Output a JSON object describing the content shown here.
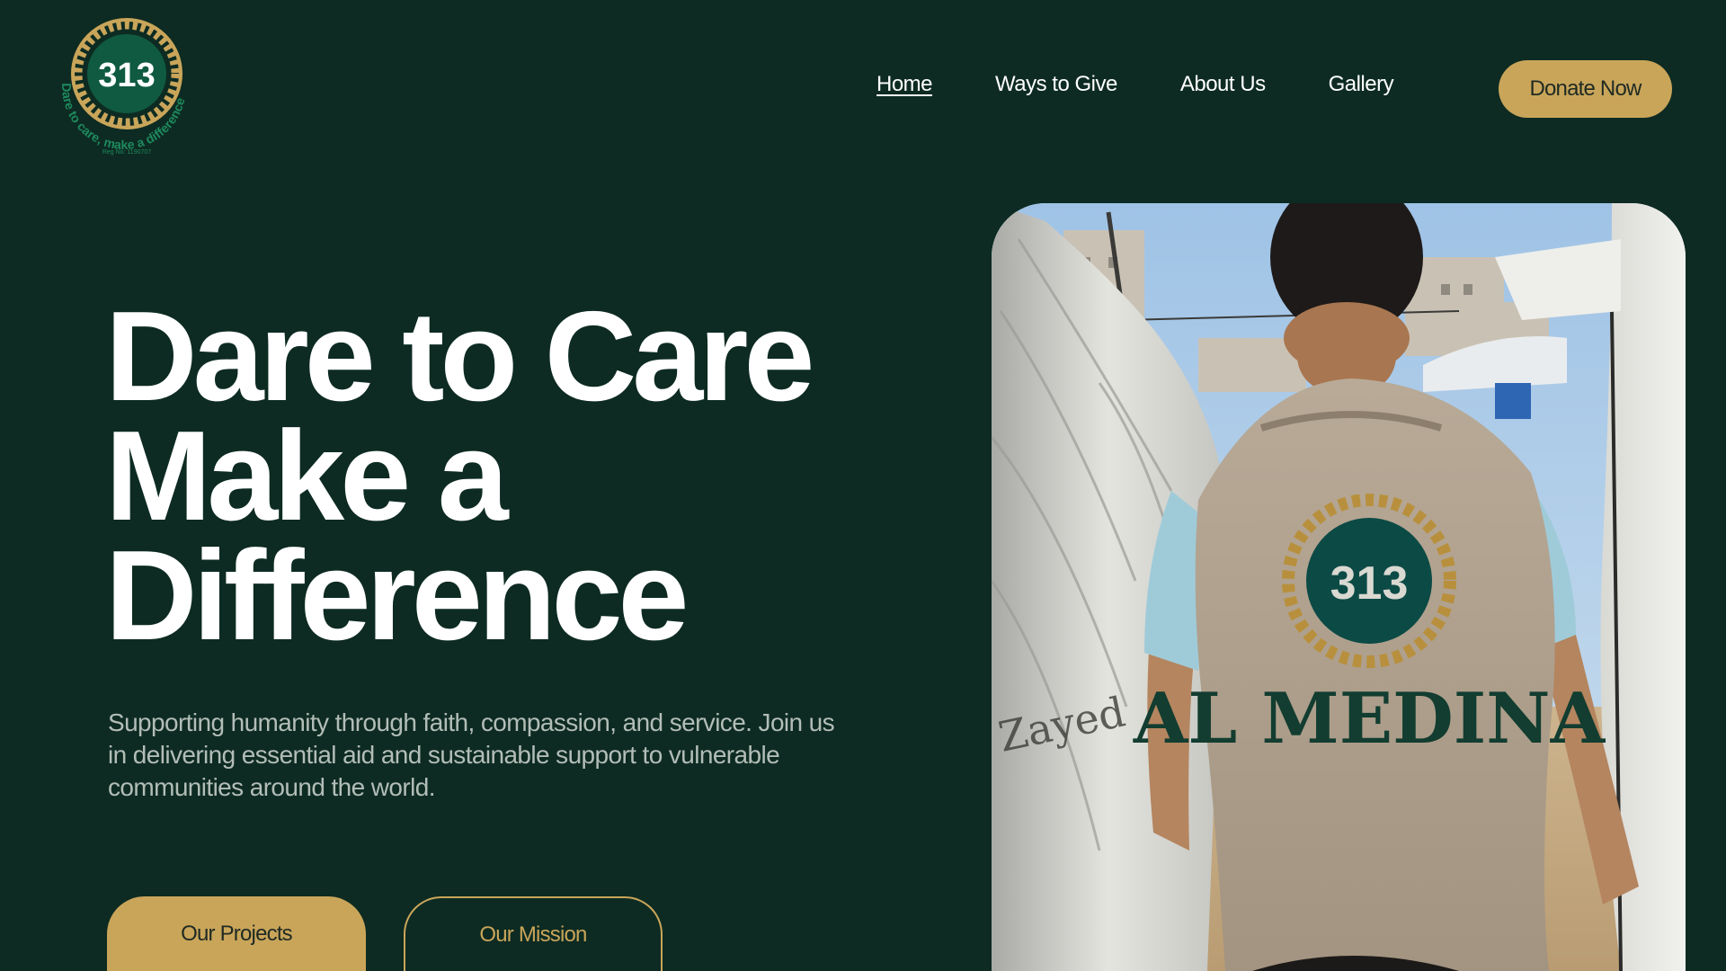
{
  "logo": {
    "number": "313",
    "tagline": "Dare to care, make a difference",
    "reg": "Reg No: 1190707",
    "colors": {
      "gold": "#c9a55a",
      "green": "#0f5a40",
      "tagline": "#1e8a5f"
    }
  },
  "nav": {
    "items": [
      {
        "label": "Home",
        "active": true
      },
      {
        "label": "Ways to Give",
        "active": false
      },
      {
        "label": "About Us",
        "active": false
      },
      {
        "label": "Gallery",
        "active": false
      }
    ],
    "donate_label": "Donate Now"
  },
  "hero": {
    "title_lines": [
      "Dare to Care",
      "Make a",
      "Difference"
    ],
    "subtitle": "Supporting humanity through faith, compassion, and service. Join us in delivering essential aid and sustainable support to vulnerable communities around the world.",
    "primary_button": "Our Projects",
    "secondary_button": "Our Mission"
  },
  "photo": {
    "vest_number": "313",
    "vest_text": "AL MEDINA",
    "tent_print": "Zayed"
  },
  "colors": {
    "background": "#0d2b22",
    "accent": "#c9a55a",
    "text": "#ffffff",
    "muted_text": "#b3bdb8"
  }
}
